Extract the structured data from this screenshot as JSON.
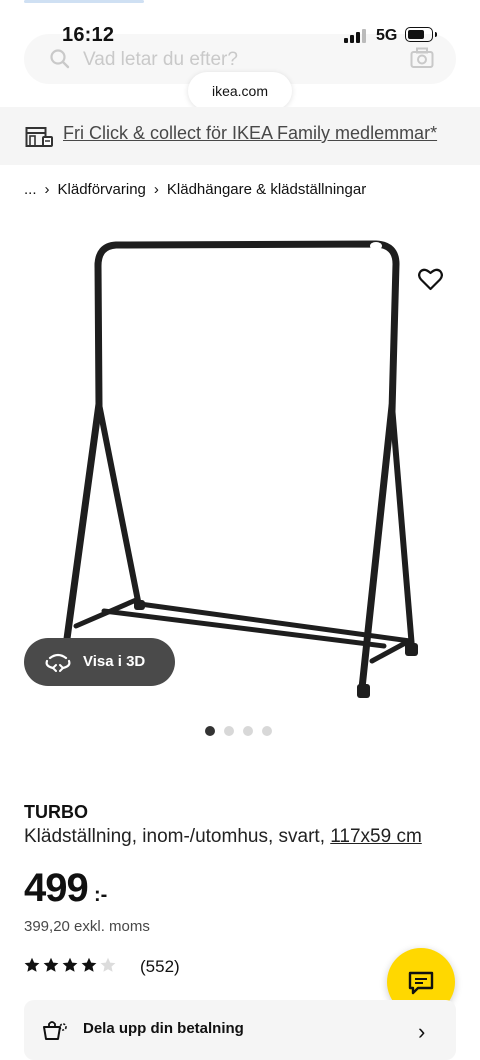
{
  "status_bar": {
    "time": "16:12",
    "network": "5G"
  },
  "search": {
    "placeholder": "Vad letar du efter?"
  },
  "browser": {
    "url": "ikea.com"
  },
  "banner": {
    "text": "Fri Click & collect för IKEA Family medlemmar*"
  },
  "breadcrumb": {
    "items": [
      "...",
      "Klädförvaring",
      "Klädhängare & klädställningar"
    ]
  },
  "product": {
    "name": "TURBO",
    "description": "Klädställning, inom-/utomhus, svart, ",
    "size": "117x59 cm",
    "price": "499",
    "price_suffix": ":-",
    "price_ex_vat": "399,20 exkl. moms",
    "rating": 4,
    "rating_max": 5,
    "reviews": "(552)"
  },
  "gallery": {
    "view3d_label": "Visa i 3D",
    "image_count": 4,
    "active_index": 0
  },
  "payment": {
    "label": "Dela upp din betalning"
  },
  "colors": {
    "brand_yellow": "#ffd800",
    "dark_button": "#4a4a4a",
    "banner_bg": "#f5f5f5"
  }
}
